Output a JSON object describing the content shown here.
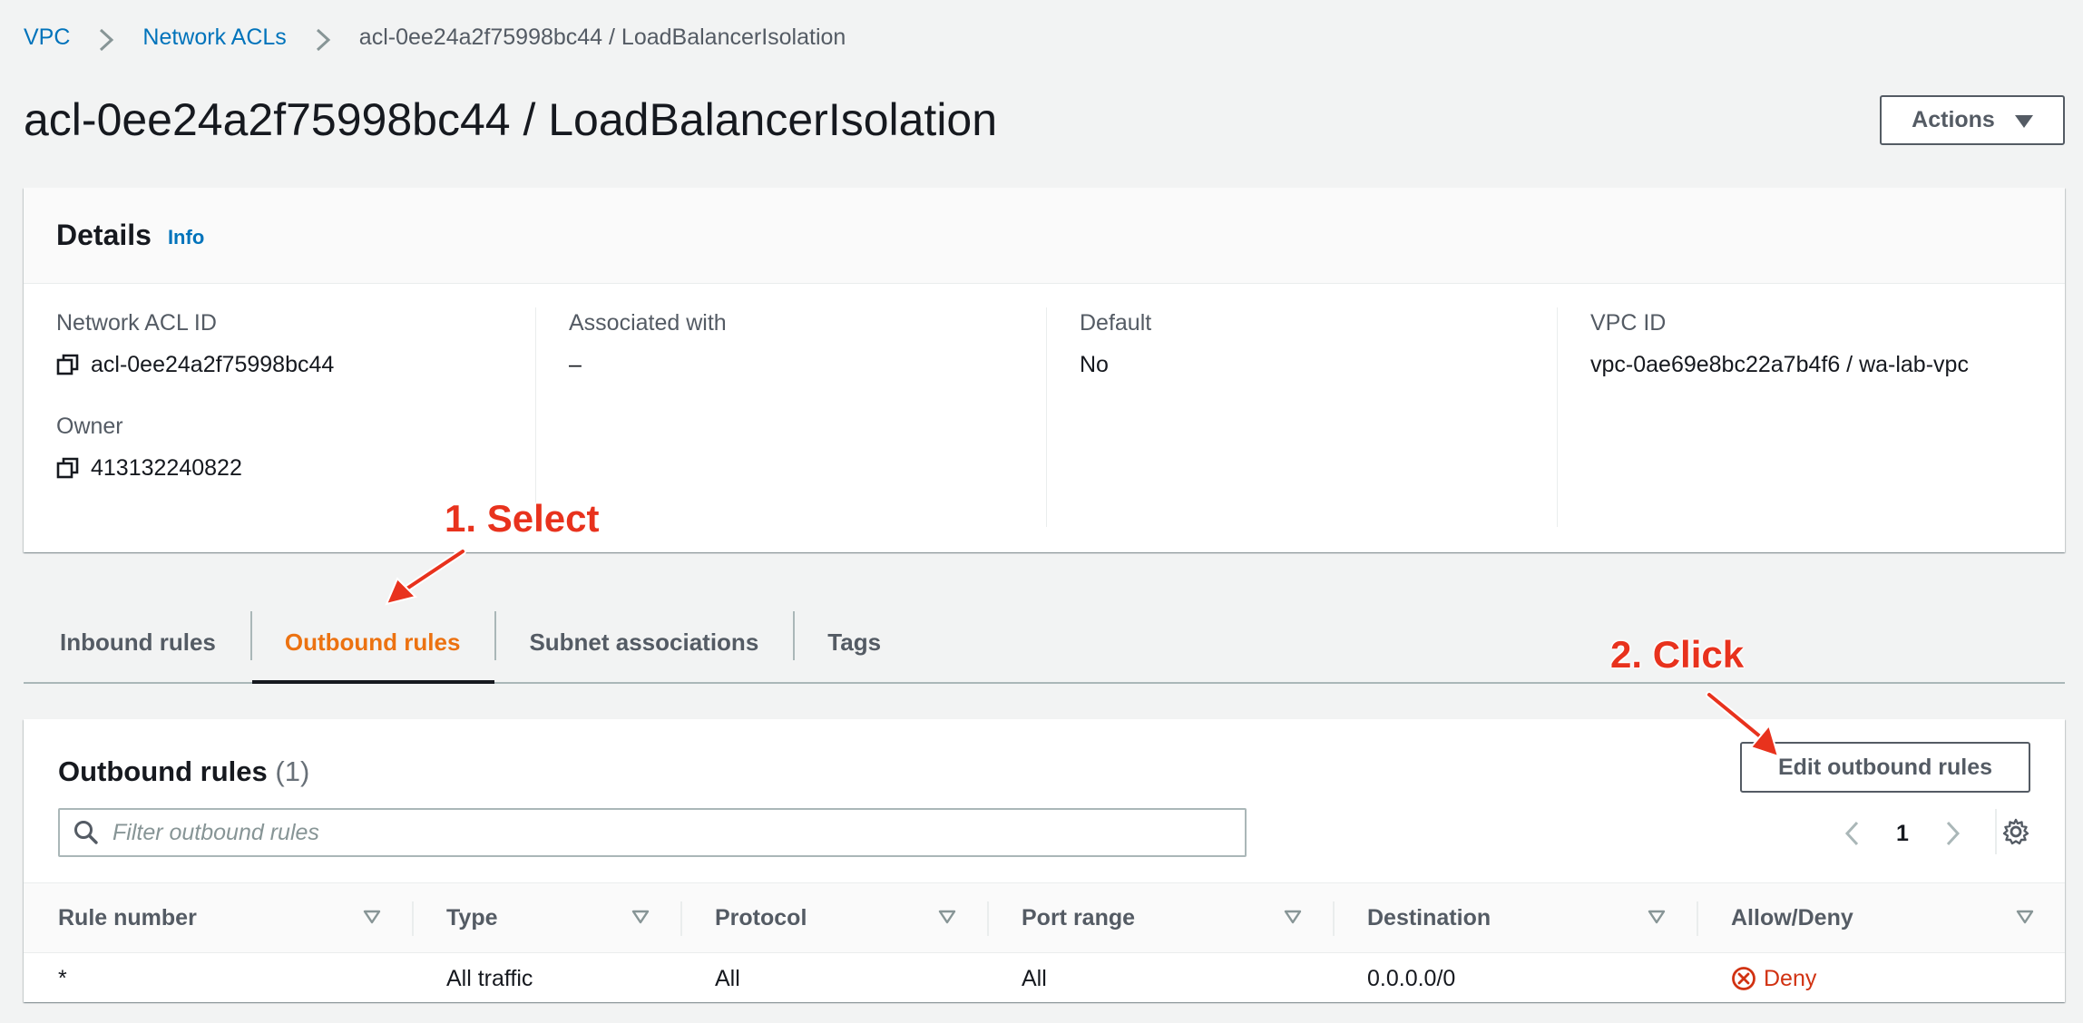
{
  "breadcrumb": {
    "items": [
      "VPC",
      "Network ACLs"
    ],
    "current": "acl-0ee24a2f75998bc44 / LoadBalancerIsolation"
  },
  "page": {
    "title": "acl-0ee24a2f75998bc44 / LoadBalancerIsolation",
    "actions_label": "Actions"
  },
  "details": {
    "title": "Details",
    "info_label": "Info",
    "network_acl_id_label": "Network ACL ID",
    "network_acl_id": "acl-0ee24a2f75998bc44",
    "owner_label": "Owner",
    "owner": "413132240822",
    "associated_label": "Associated with",
    "associated": "–",
    "default_label": "Default",
    "default": "No",
    "vpc_id_label": "VPC ID",
    "vpc_id": "vpc-0ae69e8bc22a7b4f6 / wa-lab-vpc"
  },
  "tabs": [
    {
      "label": "Inbound rules",
      "active": false
    },
    {
      "label": "Outbound rules",
      "active": true
    },
    {
      "label": "Subnet associations",
      "active": false
    },
    {
      "label": "Tags",
      "active": false
    }
  ],
  "rules": {
    "title": "Outbound rules",
    "count": "(1)",
    "edit_label": "Edit outbound rules",
    "filter_placeholder": "Filter outbound rules",
    "page_number": "1",
    "columns": [
      "Rule number",
      "Type",
      "Protocol",
      "Port range",
      "Destination",
      "Allow/Deny"
    ],
    "rows": [
      {
        "rule_number": "*",
        "type": "All traffic",
        "protocol": "All",
        "port_range": "All",
        "destination": "0.0.0.0/0",
        "action": "Deny"
      }
    ]
  },
  "annotations": {
    "step1": "1. Select",
    "step2": "2. Click"
  },
  "colors": {
    "link": "#0073bb",
    "active_tab": "#ec7211",
    "deny": "#d13212",
    "annotation": "#e8321d"
  }
}
